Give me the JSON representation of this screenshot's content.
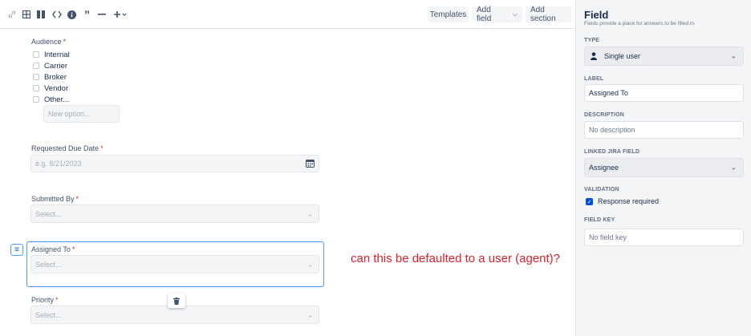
{
  "toolbar": {
    "icons": [
      "link-icon",
      "table-icon",
      "columns-icon",
      "code-icon",
      "info-icon",
      "quote-icon",
      "divider-icon",
      "insert-icon"
    ],
    "templates_label": "Templates",
    "add_field_label": "Add field",
    "add_section_label": "Add section"
  },
  "form": {
    "audience": {
      "label": "Audience",
      "required_mark": "*",
      "options": [
        "Internal",
        "Carrier",
        "Broker",
        "Vendor",
        "Other..."
      ],
      "new_option_placeholder": "New option..."
    },
    "due_date": {
      "label": "Requested Due Date",
      "required_mark": "*",
      "placeholder": "e.g. 8/21/2023"
    },
    "submitted_by": {
      "label": "Submitted By",
      "required_mark": "*",
      "placeholder": "Select..."
    },
    "assigned_to": {
      "label": "Assigned To",
      "required_mark": "*",
      "placeholder": "Select..."
    },
    "priority": {
      "label": "Priority",
      "required_mark": "*",
      "placeholder": "Select..."
    }
  },
  "annotation": "can this be defaulted to a user (agent)?",
  "panel": {
    "title": "Field",
    "subtitle": "Fields provide a place for answers to be filled in.",
    "type_label": "TYPE",
    "type_value": "Single user",
    "label_label": "LABEL",
    "label_value": "Assigned To",
    "description_label": "DESCRIPTION",
    "description_value": "No description",
    "linked_label": "LINKED JIRA FIELD",
    "linked_value": "Assignee",
    "validation_label": "VALIDATION",
    "validation_option": "Response required",
    "validation_checked": true,
    "key_label": "FIELD KEY",
    "key_value": "No field key"
  },
  "colors": {
    "accent": "#0052cc",
    "selection_border": "#4c9aff",
    "required": "#de350b",
    "annotation": "#e0202b"
  }
}
